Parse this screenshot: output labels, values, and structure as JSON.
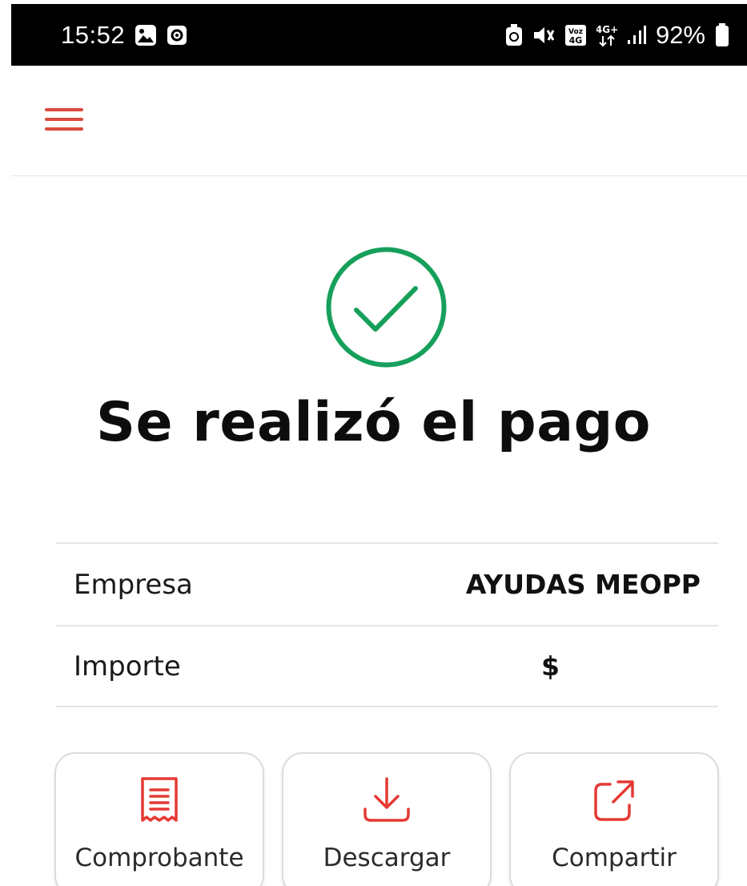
{
  "status_bar": {
    "time": "15:52",
    "battery": "92%",
    "icons_left": [
      "gallery-icon",
      "screen-record-icon"
    ],
    "icons_right": [
      "battery-saver-icon",
      "mute-icon",
      "volte-icon",
      "network-4g-icon",
      "signal-icon",
      "battery-icon"
    ]
  },
  "header": {
    "menu_icon": "hamburger-menu-icon",
    "accent_color": "#d94a3d"
  },
  "success": {
    "icon": "check-circle-icon",
    "color": "#16a05b",
    "title": "Se realizó el pago"
  },
  "details": [
    {
      "label": "Empresa",
      "value": "AYUDAS MEOPP"
    },
    {
      "label": "Importe",
      "value": "$"
    }
  ],
  "actions": [
    {
      "label": "Comprobante",
      "icon": "receipt-icon"
    },
    {
      "label": "Descargar",
      "icon": "download-icon"
    },
    {
      "label": "Compartir",
      "icon": "share-icon"
    }
  ],
  "action_icon_color": "#e53935"
}
